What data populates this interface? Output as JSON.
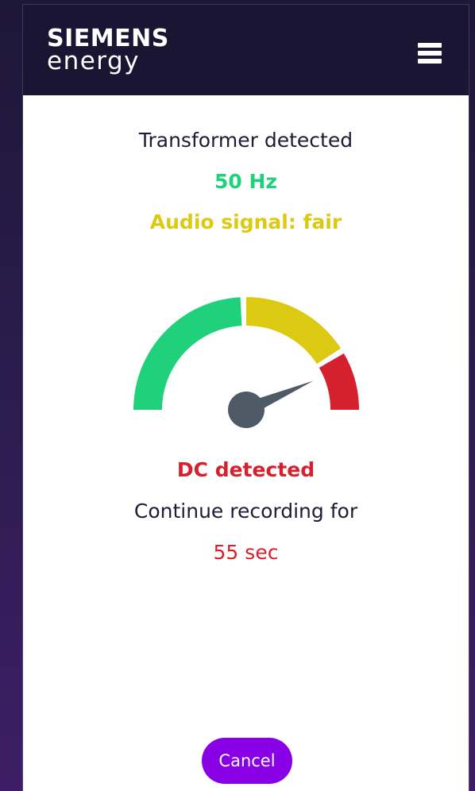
{
  "brand": {
    "line1": "SIEMENS",
    "line2": "energy"
  },
  "header": {
    "menu_icon": "hamburger-menu-icon"
  },
  "result": {
    "status": "Transformer detected",
    "frequency": "50 Hz",
    "audio_signal": "Audio signal: fair",
    "dc_status": "DC detected",
    "instruction": "Continue recording for",
    "remaining": "55 sec"
  },
  "gauge": {
    "level_fraction": 0.87,
    "zones": [
      "green",
      "yellow",
      "red"
    ]
  },
  "colors": {
    "header_bg": "#1b1534",
    "green": "#1fd17a",
    "yellow": "#dcca12",
    "red": "#d5202d",
    "needle": "#4e5a66",
    "button": "#8a00e6"
  },
  "actions": {
    "cancel_label": "Cancel"
  }
}
